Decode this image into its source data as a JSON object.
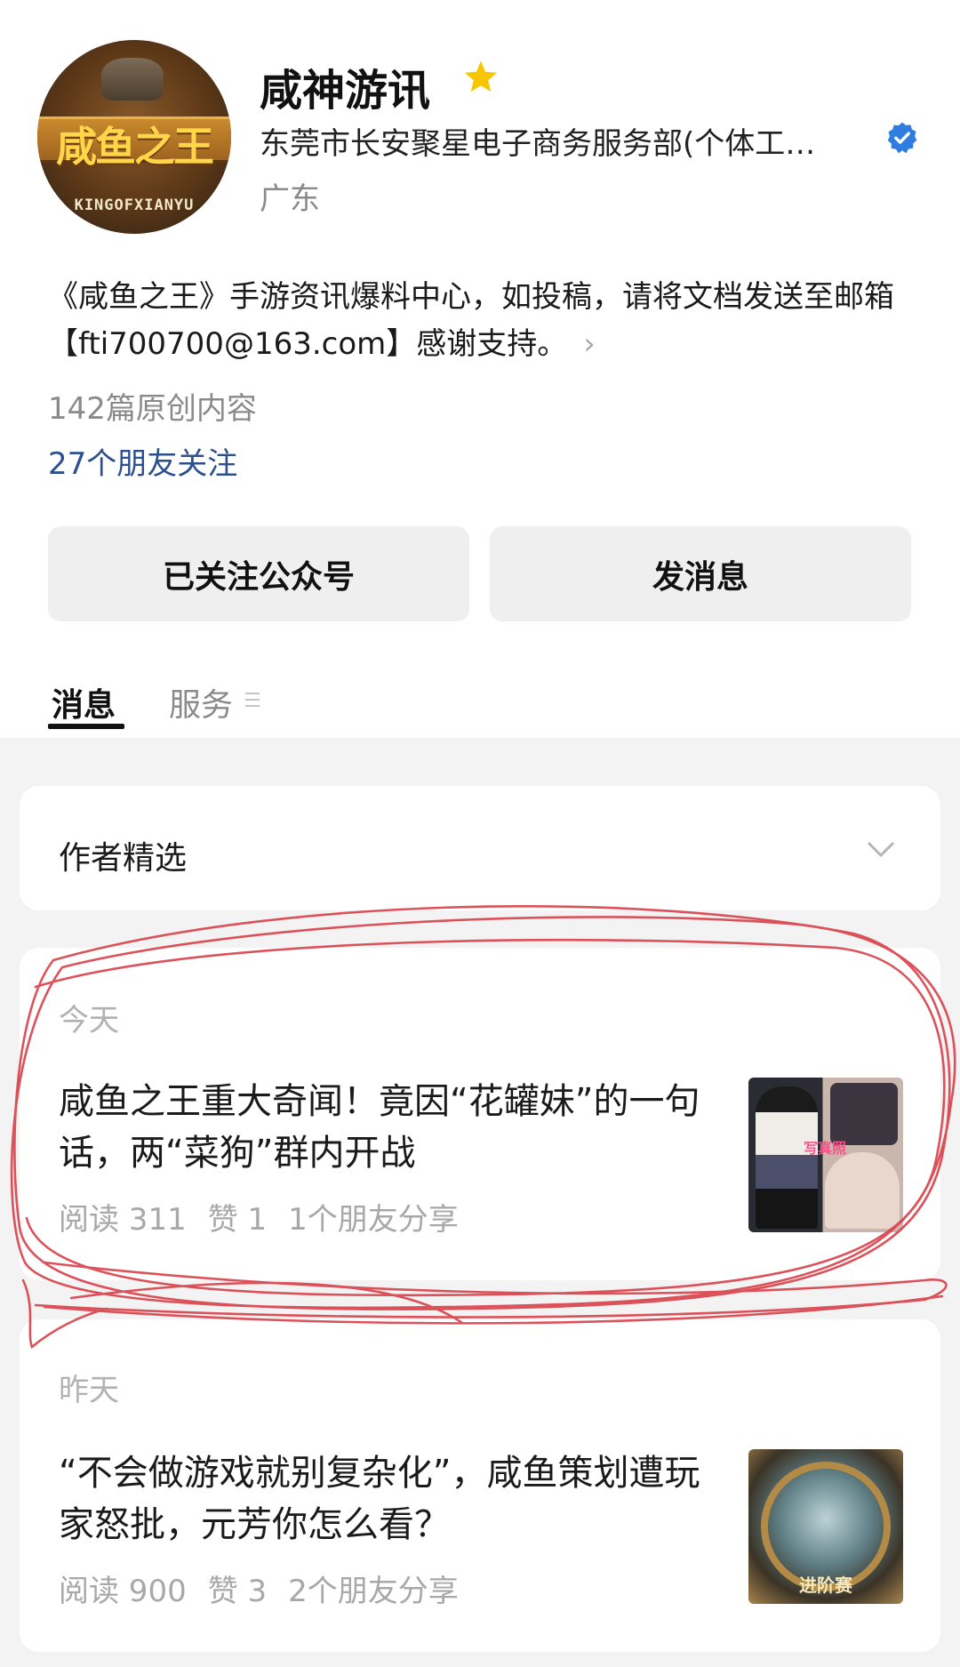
{
  "profile": {
    "name": "咸神游讯",
    "company": "东莞市长安聚星电子商务服务部(个体工…",
    "region": "广东",
    "bio": "《咸鱼之王》手游资讯爆料中心，如投稿，请将文档发送至邮箱【fti700700@163.com】感谢支持。",
    "bio_chevron": "›",
    "original_count": "142篇原创内容",
    "friends_follow": "27个朋友关注",
    "avatar_title": "咸鱼之王",
    "avatar_subtitle": "KINGOFXIANYU"
  },
  "actions": {
    "followed_label": "已关注公众号",
    "message_label": "发消息"
  },
  "tabs": [
    {
      "label": "消息",
      "active": true
    },
    {
      "label": "服务",
      "active": false
    }
  ],
  "selection": {
    "label": "作者精选"
  },
  "articles": [
    {
      "day": "今天",
      "title": "咸鱼之王重大奇闻！竟因“花罐妹”的一句话，两“菜狗”群内开战",
      "reads": "阅读 311",
      "likes": "赞 1",
      "shares": "1个朋友分享",
      "thumb_text": "写真照"
    },
    {
      "day": "昨天",
      "title": "“不会做游戏就别复杂化”，咸鱼策划遭玩家怒批，元芳你怎么看？",
      "reads": "阅读 900",
      "likes": "赞 3",
      "shares": "2个朋友分享",
      "thumb_text": "进阶赛"
    }
  ],
  "colors": {
    "star": "#f7c600",
    "verified": "#2f7de1",
    "link": "#2c4f8e",
    "annotation": "#d9404a"
  }
}
